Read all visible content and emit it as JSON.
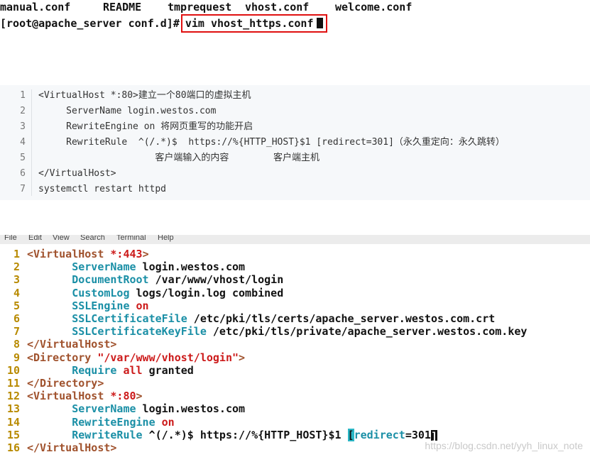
{
  "terminal": {
    "ls_files": [
      "manual.conf",
      "README",
      "tmprequest",
      "vhost.conf",
      "welcome.conf"
    ],
    "prompt": "[root@apache_server conf.d]#",
    "command": "vim vhost_https.conf"
  },
  "snippet": {
    "lines": [
      {
        "n": "1",
        "text": "<VirtualHost *:80>建立一个80端口的虚拟主机"
      },
      {
        "n": "2",
        "text": "     ServerName login.westos.com"
      },
      {
        "n": "3",
        "text": "     RewriteEngine on 将网页重写的功能开启"
      },
      {
        "n": "4",
        "text": "     RewriteRule  ^(/.*)$  https://%{HTTP_HOST}$1 [redirect=301]（永久重定向：永久跳转）"
      },
      {
        "n": "5",
        "text": "                     客户端输入的内容        客户端主机"
      },
      {
        "n": "6",
        "text": "</VirtualHost>"
      },
      {
        "n": "7",
        "text": "systemctl restart httpd"
      }
    ]
  },
  "vim": {
    "menu": [
      "File",
      "Edit",
      "View",
      "Search",
      "Terminal",
      "Help"
    ],
    "lines": [
      {
        "n": "1",
        "a": "<VirtualHost ",
        "b": "*:443",
        "c": ">"
      },
      {
        "n": "2",
        "k": "ServerName",
        "v": " login.westos.com"
      },
      {
        "n": "3",
        "k": "DocumentRoot",
        "v": " /var/www/vhost/login"
      },
      {
        "n": "4",
        "k": "CustomLog",
        "v": " logs/login.log combined"
      },
      {
        "n": "5",
        "k": "SSLEngine",
        "r": " on"
      },
      {
        "n": "6",
        "k": "SSLCertificateFile",
        "v": " /etc/pki/tls/certs/apache_server.westos.com.crt"
      },
      {
        "n": "7",
        "k": "SSLCertificateKeyFile",
        "v": " /etc/pki/tls/private/apache_server.westos.com.key"
      },
      {
        "n": "8",
        "a": "</VirtualHost>"
      },
      {
        "n": "9",
        "a": "<Directory ",
        "b": "\"/var/www/vhost/login\"",
        "c": ">"
      },
      {
        "n": "10",
        "k": "Require",
        "r": " all",
        "v": " granted"
      },
      {
        "n": "11",
        "a": "</Directory>"
      },
      {
        "n": "12",
        "a": "<VirtualHost ",
        "b": "*:80",
        "c": ">"
      },
      {
        "n": "13",
        "k": "ServerName",
        "v": " login.westos.com"
      },
      {
        "n": "14",
        "k": "RewriteEngine",
        "r": " on"
      },
      {
        "n": "15",
        "k": "RewriteRule",
        "v": " ^(/.*)$ https://%{HTTP_HOST}$1 ",
        "br": "[",
        "k2": "redirect",
        "eq": "=301",
        "br2": "]"
      },
      {
        "n": "16",
        "a": "</VirtualHost>"
      }
    ]
  },
  "watermark": "https://blog.csdn.net/yyh_linux_note"
}
